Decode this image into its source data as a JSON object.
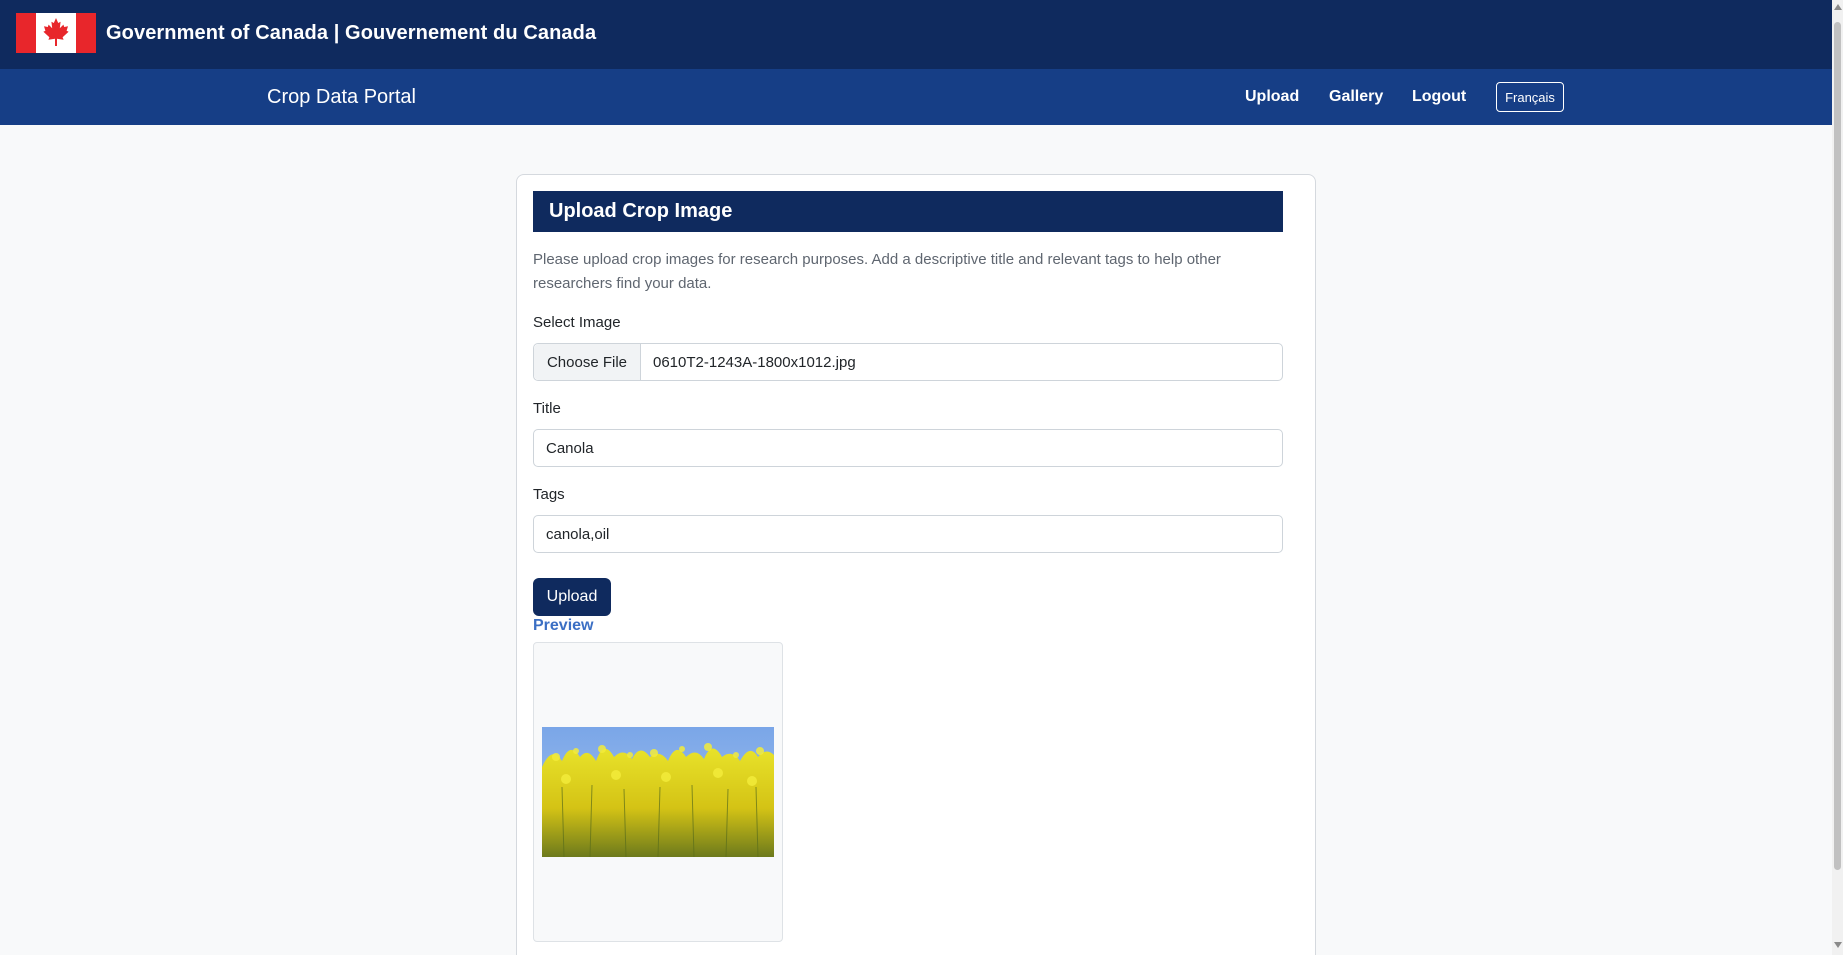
{
  "gov": {
    "title": "Government of Canada | Gouvernement du Canada"
  },
  "nav": {
    "brand": "Crop Data Portal",
    "links": [
      "Upload",
      "Gallery",
      "Logout"
    ],
    "language_toggle": "Français"
  },
  "form": {
    "heading": "Upload Crop Image",
    "intro": "Please upload crop images for research purposes. Add a descriptive title and relevant tags to help other researchers find your data.",
    "image_label": "Select Image",
    "file_button": "Choose File",
    "file_name": "0610T2-1243A-1800x1012.jpg",
    "title_label": "Title",
    "title_value": "Canola",
    "tags_label": "Tags",
    "tags_value": "canola,oil",
    "submit_label": "Upload",
    "preview_label": "Preview"
  },
  "colors": {
    "gov_bar": "#0f2a5e",
    "nav_bar": "#163e86",
    "flag_red": "#e8262b",
    "accent_link": "#3b6fc4"
  },
  "icons": [
    "canada-flag-icon",
    "maple-leaf-icon"
  ]
}
